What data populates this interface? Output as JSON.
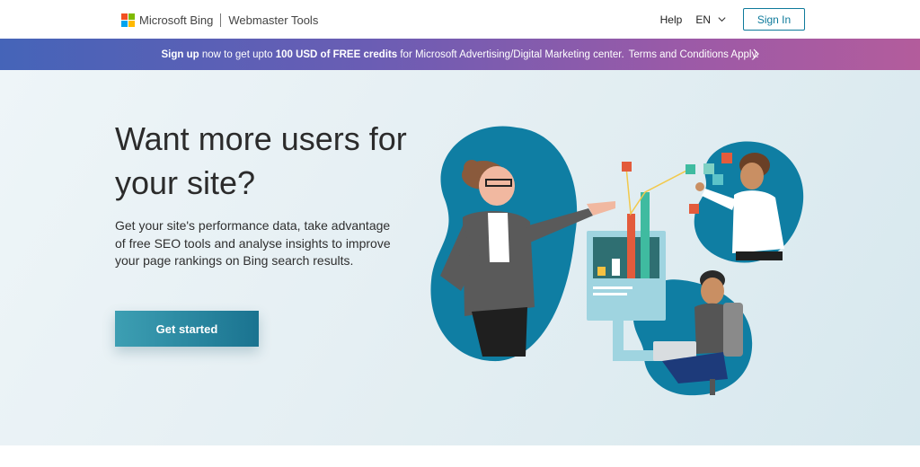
{
  "header": {
    "brand_name": "Microsoft Bing",
    "product_name": "Webmaster Tools",
    "help_label": "Help",
    "language": "EN",
    "sign_in_label": "Sign In"
  },
  "banner": {
    "sign_up": "Sign up",
    "text_1": " now to get upto ",
    "credits": "100 USD of FREE credits",
    "text_2": " for Microsoft Advertising/Digital Marketing center.",
    "terms": "Terms and Conditions Apply."
  },
  "hero": {
    "title": "Want more users for your site?",
    "description": "Get your site's performance data, take advantage of free SEO tools and analyse insights to improve your page rankings on Bing search results.",
    "cta_label": "Get started"
  },
  "colors": {
    "accent": "#0e7a9b",
    "banner_start": "#4564b8",
    "banner_end": "#b35c9c",
    "blob": "#0f7ea3",
    "chart_green": "#3fbba0",
    "chart_orange": "#e35b3c"
  },
  "icons": {
    "logo": "microsoft-logo-icon",
    "language_chevron": "chevron-down-icon",
    "banner_chevron": "chevron-right-icon"
  }
}
